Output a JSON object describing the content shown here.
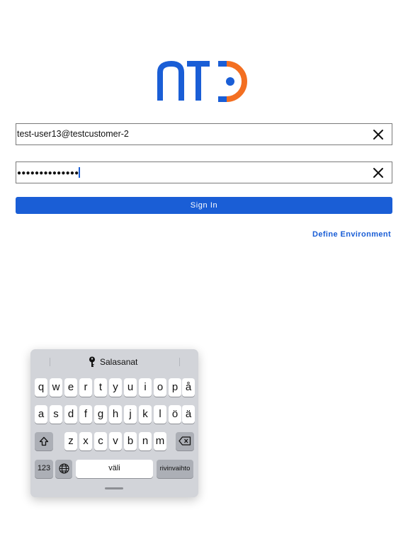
{
  "login": {
    "username_value": "test-user13@testcustomer-2",
    "password_mask": "●●●●●●●●●●●●●●",
    "sign_in_label": "Sign In",
    "define_env_label": "Define Environment"
  },
  "colors": {
    "logo_blue": "#1a5ed6",
    "logo_orange": "#f36f21",
    "button_blue": "#1a5ed6"
  },
  "keyboard": {
    "suggestion_label": "Salasanat",
    "row1": [
      "q",
      "w",
      "e",
      "r",
      "t",
      "y",
      "u",
      "i",
      "o",
      "p",
      "å"
    ],
    "row2": [
      "a",
      "s",
      "d",
      "f",
      "g",
      "h",
      "j",
      "k",
      "l",
      "ö",
      "ä"
    ],
    "row3": [
      "z",
      "x",
      "c",
      "v",
      "b",
      "n",
      "m"
    ],
    "numbers_label": "123",
    "space_label": "väli",
    "return_label": "rivinvaihto"
  }
}
